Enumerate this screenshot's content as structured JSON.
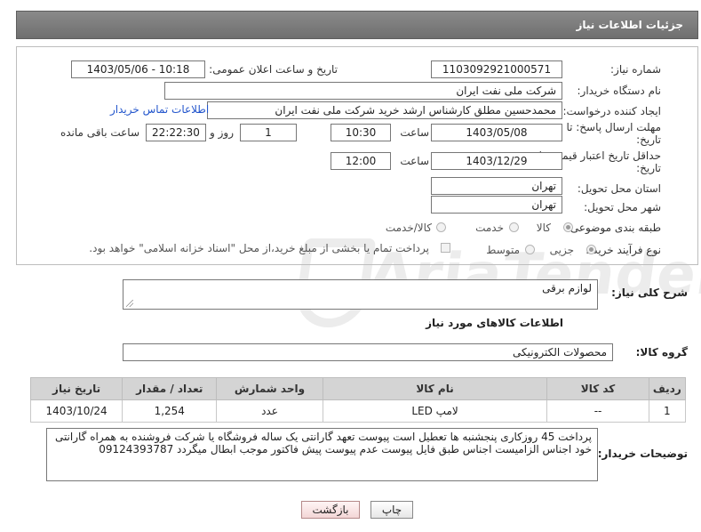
{
  "page_title": "جزئیات اطلاعات نیاز",
  "watermark": {
    "text": "AriaTender.neT"
  },
  "fields": {
    "need_number": {
      "label": "شماره نیاز:",
      "value": "1103092921000571"
    },
    "announce_datetime": {
      "label": "تاریخ و ساعت اعلان عمومی:",
      "value": "1403/05/06 - 10:18"
    },
    "buyer_org": {
      "label": "نام دستگاه خریدار:",
      "value": "شرکت ملی نفت ایران"
    },
    "requester": {
      "label": "ایجاد کننده درخواست:",
      "value": "محمدحسین مطلق کارشناس ارشد خرید شرکت ملی نفت ایران"
    },
    "buyer_contact_link": "اطلاعات تماس خریدار",
    "reply_deadline": {
      "label_line1": "مهلت ارسال پاسخ: تا",
      "label_line2": "تاریخ:",
      "date": "1403/05/08",
      "time_label": "ساعت",
      "time": "10:30",
      "days": "1",
      "days_label": "روز و",
      "remaining": "22:22:30",
      "remaining_label": "ساعت باقی مانده"
    },
    "price_validity": {
      "label_line1": "حداقل تاریخ اعتبار قیمت: تا",
      "label_line2": "تاریخ:",
      "date": "1403/12/29",
      "time_label": "ساعت",
      "time": "12:00"
    },
    "delivery_province": {
      "label": "استان محل تحویل:",
      "value": "تهران"
    },
    "delivery_city": {
      "label": "شهر محل تحویل:",
      "value": "تهران"
    },
    "category": {
      "label": "طبقه بندی موضوعی:",
      "options": [
        "کالا",
        "خدمت",
        "کالا/خدمت"
      ],
      "selected": "کالا"
    },
    "purchase_process": {
      "label": "نوع فرآیند خرید :",
      "options": [
        "جزیی",
        "متوسط"
      ],
      "selected": "جزیی",
      "treasury_note": "پرداخت تمام یا بخشی از مبلغ خرید،از محل \"اسناد خزانه اسلامی\" خواهد بود."
    }
  },
  "general_description": {
    "label": "شرح کلی نیاز:",
    "value": "لوازم برقی"
  },
  "items_section_title": "اطلاعات کالاهای مورد نیاز",
  "goods_group": {
    "label": "گروه کالا:",
    "value": "محصولات الکترونیکی"
  },
  "items_table": {
    "headers": [
      "ردیف",
      "کد کالا",
      "نام کالا",
      "واحد شمارش",
      "تعداد / مقدار",
      "تاریخ نیاز"
    ],
    "rows": [
      [
        "1",
        "--",
        "لامپ LED",
        "عدد",
        "1,254",
        "1403/10/24"
      ]
    ]
  },
  "buyer_notes": {
    "label": "توضیحات خریدار:",
    "value": "پرداخت 45 روزکاری پنجشنبه ها تعطیل است پیوست تعهد گارانتی یک ساله  فروشگاه یا شرکت فروشنده  به همراه گارانتی خود اجناس الزامیست اجناس  طبق  فایل پیوست عدم پیوست پیش فاکتور موجب ابطال میگردد 09124393787"
  },
  "buttons": {
    "print": "چاپ",
    "back": "بازگشت"
  }
}
